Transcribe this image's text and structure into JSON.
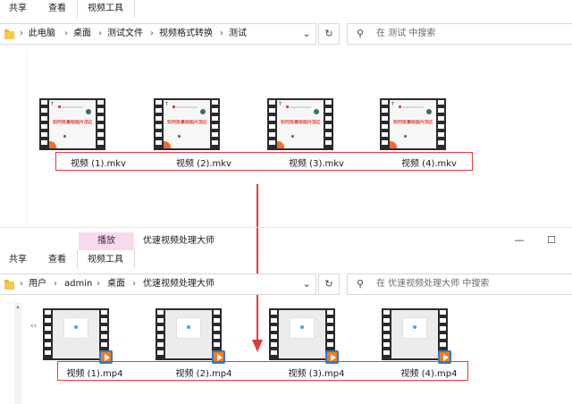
{
  "window1": {
    "tabs": [
      "共享",
      "查看",
      "视频工具"
    ],
    "breadcrumb": [
      "此电脑",
      "桌面",
      "测试文件",
      "视频格式转换",
      "测试"
    ],
    "search_placeholder": "在 测试 中搜索",
    "thumb_title": "如何批量给图片加边框?",
    "files": [
      "视频 (1).mkv",
      "视频 (2).mkv",
      "视频 (3).mkv",
      "视频 (4).mkv"
    ]
  },
  "window2": {
    "context_tab": "播放",
    "title": "优速视频处理大师",
    "tabs": [
      "共享",
      "查看",
      "视频工具"
    ],
    "breadcrumb": [
      "用户",
      "admin",
      "桌面",
      "优速视频处理大师"
    ],
    "search_placeholder": "在 优速视频处理大师 中搜索",
    "files": [
      "视频 (1).mp4",
      "视频 (2).mp4",
      "视频 (3).mp4",
      "视频 (4).mp4"
    ],
    "controls": {
      "minimize": "—",
      "maximize": "☐"
    }
  },
  "icons": {
    "chevron": "›",
    "dropdown": "⌄",
    "refresh": "↻",
    "search": "⚲",
    "back": "‹‹",
    "scroll_up": "▴"
  },
  "colors": {
    "highlight": "#e33b3b",
    "play_tab": "#f9d9ec",
    "badge": "#f07d1e"
  }
}
